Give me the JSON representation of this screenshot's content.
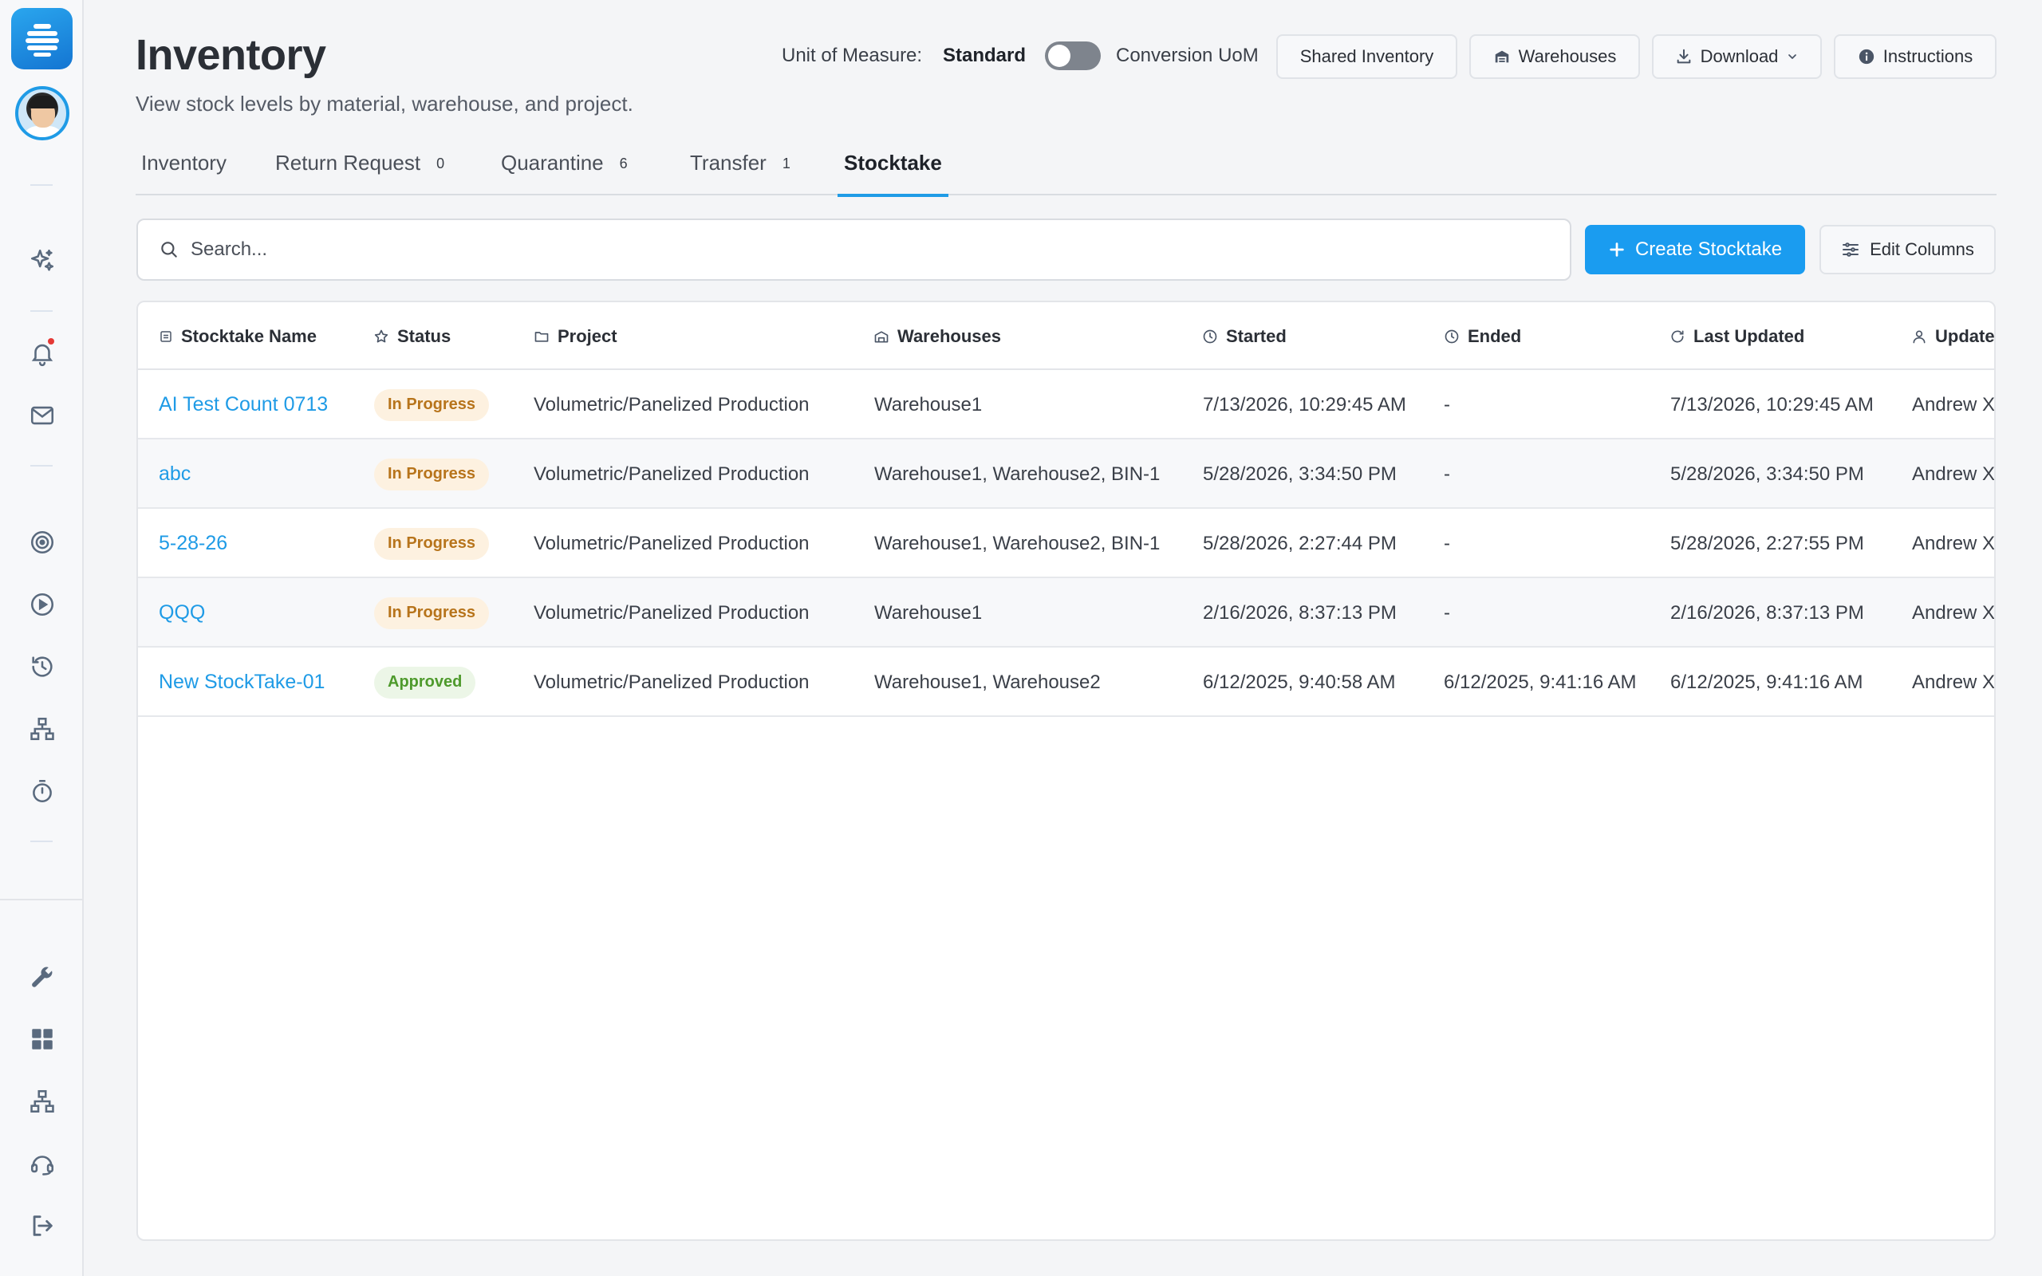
{
  "page": {
    "title": "Inventory",
    "subtitle": "View stock levels by material, warehouse, and project."
  },
  "header": {
    "uom_label": "Unit of Measure:",
    "uom_standard": "Standard",
    "uom_conversion": "Conversion UoM",
    "uom_toggle_on": false,
    "buttons": {
      "shared_inventory": "Shared Inventory",
      "warehouses": "Warehouses",
      "download": "Download",
      "instructions": "Instructions"
    }
  },
  "tabs": [
    {
      "label": "Inventory",
      "count": ""
    },
    {
      "label": "Return Request",
      "count": "0"
    },
    {
      "label": "Quarantine",
      "count": "6"
    },
    {
      "label": "Transfer",
      "count": "1"
    },
    {
      "label": "Stocktake",
      "count": "",
      "active": true
    }
  ],
  "search": {
    "placeholder": "Search..."
  },
  "actions": {
    "create": "Create Stocktake",
    "edit_columns": "Edit Columns"
  },
  "table": {
    "columns": [
      "Stocktake Name",
      "Status",
      "Project",
      "Warehouses",
      "Started",
      "Ended",
      "Last Updated",
      "Updated By"
    ],
    "rows": [
      {
        "name": "AI Test Count 0713",
        "status": "In Progress",
        "project": "Volumetric/Panelized Production",
        "warehouses": "Warehouse1",
        "started": "7/13/2026, 10:29:45 AM",
        "ended": "-",
        "last_updated": "7/13/2026, 10:29:45 AM",
        "updated_by": "Andrew X"
      },
      {
        "name": "abc",
        "status": "In Progress",
        "project": "Volumetric/Panelized Production",
        "warehouses": "Warehouse1, Warehouse2, BIN-1",
        "started": "5/28/2026, 3:34:50 PM",
        "ended": "-",
        "last_updated": "5/28/2026, 3:34:50 PM",
        "updated_by": "Andrew X"
      },
      {
        "name": "5-28-26",
        "status": "In Progress",
        "project": "Volumetric/Panelized Production",
        "warehouses": "Warehouse1, Warehouse2, BIN-1",
        "started": "5/28/2026, 2:27:44 PM",
        "ended": "-",
        "last_updated": "5/28/2026, 2:27:55 PM",
        "updated_by": "Andrew X"
      },
      {
        "name": "QQQ",
        "status": "In Progress",
        "project": "Volumetric/Panelized Production",
        "warehouses": "Warehouse1",
        "started": "2/16/2026, 8:37:13 PM",
        "ended": "-",
        "last_updated": "2/16/2026, 8:37:13 PM",
        "updated_by": "Andrew X"
      },
      {
        "name": "New StockTake-01",
        "status": "Approved",
        "project": "Volumetric/Panelized Production",
        "warehouses": "Warehouse1, Warehouse2",
        "started": "6/12/2025, 9:40:58 AM",
        "ended": "6/12/2025, 9:41:16 AM",
        "last_updated": "6/12/2025, 9:41:16 AM",
        "updated_by": "Andrew X"
      }
    ]
  },
  "sidebar": {
    "icons": [
      "sparkle-icon",
      "bell-icon",
      "mail-icon",
      "target-icon",
      "play-icon",
      "history-icon",
      "network-icon",
      "timer-icon",
      "wrench-icon",
      "grid-icon",
      "sitemap-icon",
      "support-icon",
      "logout-icon"
    ]
  },
  "colors": {
    "accent": "#1a9cf0",
    "progress_badge_text": "#b7741b",
    "approved_badge_text": "#4e9a2c"
  }
}
